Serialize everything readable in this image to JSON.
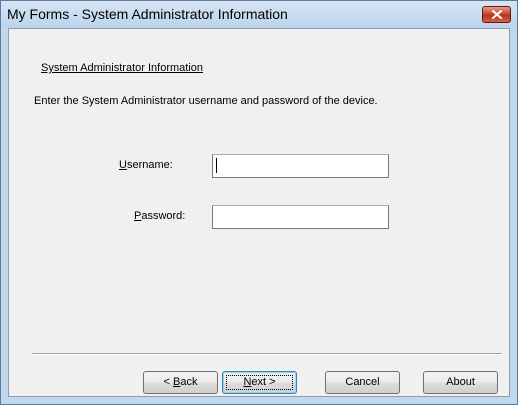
{
  "window": {
    "title": "My Forms - System Administrator Information"
  },
  "form": {
    "section_title": "System Administrator Information",
    "instructions": "Enter the System Administrator username and password of the device.",
    "username": {
      "mnemonic": "U",
      "label_rest": "sername:",
      "value": ""
    },
    "password": {
      "mnemonic": "P",
      "label_rest": "assword:",
      "value": ""
    }
  },
  "buttons": {
    "back": {
      "prefix": "< ",
      "mnemonic": "B",
      "rest": "ack"
    },
    "next": {
      "mnemonic": "N",
      "rest": "ext >"
    },
    "cancel": "Cancel",
    "about": "About"
  },
  "icons": {
    "close": "close-icon"
  },
  "colors": {
    "titlebar": "#c2d6ec",
    "client_background": "#f0f0f0",
    "close_button": "#c44330"
  }
}
